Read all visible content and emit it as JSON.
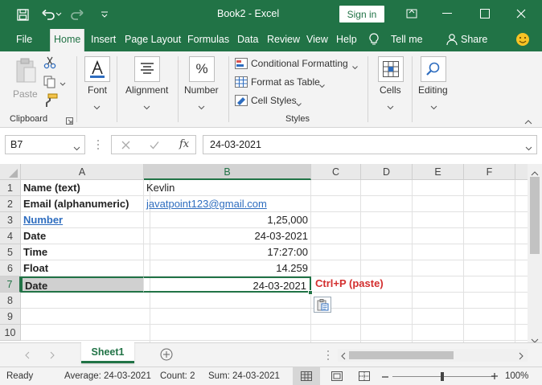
{
  "title": "Book2  -  Excel",
  "signin_label": "Sign in",
  "tabs": [
    "File",
    "Home",
    "Insert",
    "Page Layout",
    "Formulas",
    "Data",
    "Review",
    "View",
    "Help",
    "Tell me",
    "Share"
  ],
  "ribbon": {
    "paste": "Paste",
    "clipboard": "Clipboard",
    "font": "Font",
    "alignment": "Alignment",
    "number": "Number",
    "conditional_formatting": "Conditional Formatting",
    "format_as_table": "Format as Table",
    "cell_styles": "Cell Styles",
    "styles": "Styles",
    "cells": "Cells",
    "editing": "Editing"
  },
  "formula_bar": {
    "name_box": "B7",
    "fx": "fx",
    "value": "24-03-2021"
  },
  "columns": [
    "A",
    "B",
    "C",
    "D",
    "E",
    "F"
  ],
  "rows": [
    "1",
    "2",
    "3",
    "4",
    "5",
    "6",
    "7",
    "8",
    "9",
    "10"
  ],
  "cells": {
    "a1": "Name (text)",
    "b1": "Kevlin",
    "a2": "Email (alphanumeric)",
    "b2": "javatpoint123@gmail.com",
    "a3": "Number",
    "b3": "1,25,000",
    "a4": "Date",
    "b4": "24-03-2021",
    "a5": "Time",
    "b5": "17:27:00",
    "a6": "Float",
    "b6": "14.259",
    "a7": "Date",
    "b7": "24-03-2021",
    "c7": "Ctrl+P (paste)"
  },
  "sheet_tab": "Sheet1",
  "status": {
    "ready": "Ready",
    "average": "Average: 24-03-2021",
    "count": "Count: 2",
    "sum": "Sum: 24-03-2021",
    "zoom": "100%"
  },
  "colors": {
    "accent": "#217346",
    "annotation": "#d32f2f",
    "link": "#2e6dbf"
  }
}
